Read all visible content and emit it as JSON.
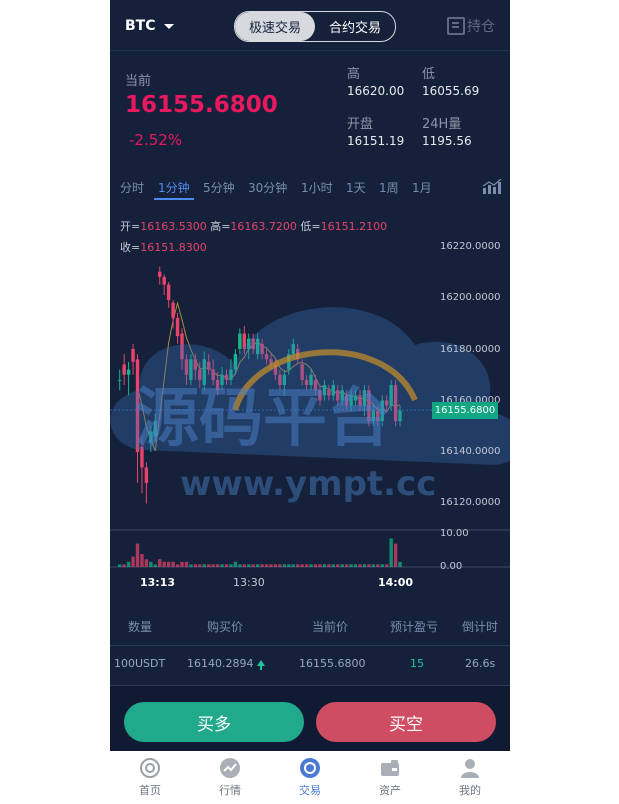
{
  "header": {
    "symbol": "BTC",
    "tabs": [
      "极速交易",
      "合约交易"
    ],
    "active_tab": 0,
    "hold_label": "持仓"
  },
  "ticker": {
    "current_label": "当前",
    "price": "16155.6800",
    "change": "-2.52%",
    "stats": [
      {
        "label": "高",
        "value": "16620.00"
      },
      {
        "label": "低",
        "value": "16055.69"
      },
      {
        "label": "开盘",
        "value": "16151.19"
      },
      {
        "label": "24H量",
        "value": "1195.56"
      }
    ]
  },
  "timeframes": [
    "分时",
    "1分钟",
    "5分钟",
    "30分钟",
    "1小时",
    "1天",
    "1周",
    "1月"
  ],
  "active_timeframe": 1,
  "ohlc": {
    "open_label": "开=",
    "open": "16163.5300",
    "high_label": "高=",
    "high": "16163.7200",
    "low_label": "低=",
    "low": "16151.2100",
    "close_label": "收=",
    "close": "16151.8300"
  },
  "chart": {
    "y_labels": [
      "16220.0000",
      "16200.0000",
      "16180.0000",
      "16160.0000",
      "16140.0000",
      "16120.0000"
    ],
    "current_tag": "16155.6800",
    "vol_labels": [
      "10.00",
      "0.00"
    ],
    "x_labels": [
      "13:13",
      "13:30",
      "14:00"
    ],
    "up_color": "#14b88a",
    "down_color": "#e8436b"
  },
  "chart_data": {
    "type": "candlestick",
    "ylim": [
      16112,
      16235
    ],
    "volume_ylim": [
      0,
      13
    ],
    "x_labels": [
      "13:13",
      "13:30",
      "14:00"
    ],
    "candles": [
      {
        "o": 16168,
        "c": 16168,
        "h": 16172,
        "l": 16164,
        "v": 1
      },
      {
        "o": 16174,
        "c": 16170,
        "h": 16178,
        "l": 16166,
        "v": 1
      },
      {
        "o": 16170,
        "c": 16172,
        "h": 16175,
        "l": 16162,
        "v": 2
      },
      {
        "o": 16180,
        "c": 16175,
        "h": 16182,
        "l": 16170,
        "v": 4
      },
      {
        "o": 16176,
        "c": 16140,
        "h": 16178,
        "l": 16128,
        "v": 9
      },
      {
        "o": 16142,
        "c": 16134,
        "h": 16146,
        "l": 16124,
        "v": 5
      },
      {
        "o": 16134,
        "c": 16128,
        "h": 16136,
        "l": 16120,
        "v": 3
      },
      {
        "o": 16144,
        "c": 16148,
        "h": 16150,
        "l": 16140,
        "v": 2
      },
      {
        "o": 16146,
        "c": 16152,
        "h": 16155,
        "l": 16144,
        "v": 1
      },
      {
        "o": 16210,
        "c": 16208,
        "h": 16212,
        "l": 16205,
        "v": 3
      },
      {
        "o": 16208,
        "c": 16205,
        "h": 16209,
        "l": 16201,
        "v": 2
      },
      {
        "o": 16205,
        "c": 16199,
        "h": 16206,
        "l": 16196,
        "v": 2
      },
      {
        "o": 16198,
        "c": 16192,
        "h": 16199,
        "l": 16188,
        "v": 2
      },
      {
        "o": 16192,
        "c": 16185,
        "h": 16194,
        "l": 16182,
        "v": 1
      },
      {
        "o": 16186,
        "c": 16176,
        "h": 16188,
        "l": 16172,
        "v": 2
      },
      {
        "o": 16176,
        "c": 16170,
        "h": 16178,
        "l": 16166,
        "v": 2
      },
      {
        "o": 16168,
        "c": 16176,
        "h": 16178,
        "l": 16166,
        "v": 1
      },
      {
        "o": 16176,
        "c": 16172,
        "h": 16178,
        "l": 16168,
        "v": 1
      },
      {
        "o": 16172,
        "c": 16168,
        "h": 16175,
        "l": 16165,
        "v": 1
      },
      {
        "o": 16166,
        "c": 16176,
        "h": 16179,
        "l": 16164,
        "v": 1
      },
      {
        "o": 16175,
        "c": 16172,
        "h": 16178,
        "l": 16170,
        "v": 1
      },
      {
        "o": 16172,
        "c": 16168,
        "h": 16176,
        "l": 16166,
        "v": 1
      },
      {
        "o": 16168,
        "c": 16164,
        "h": 16171,
        "l": 16162,
        "v": 1
      },
      {
        "o": 16166,
        "c": 16170,
        "h": 16173,
        "l": 16164,
        "v": 1
      },
      {
        "o": 16170,
        "c": 16168,
        "h": 16172,
        "l": 16166,
        "v": 1
      },
      {
        "o": 16168,
        "c": 16172,
        "h": 16176,
        "l": 16166,
        "v": 1
      },
      {
        "o": 16172,
        "c": 16178,
        "h": 16180,
        "l": 16170,
        "v": 2
      },
      {
        "o": 16180,
        "c": 16186,
        "h": 16188,
        "l": 16178,
        "v": 1
      },
      {
        "o": 16186,
        "c": 16180,
        "h": 16189,
        "l": 16178,
        "v": 1
      },
      {
        "o": 16180,
        "c": 16184,
        "h": 16186,
        "l": 16176,
        "v": 1
      },
      {
        "o": 16184,
        "c": 16180,
        "h": 16186,
        "l": 16178,
        "v": 1
      },
      {
        "o": 16178,
        "c": 16184,
        "h": 16186,
        "l": 16176,
        "v": 1
      },
      {
        "o": 16182,
        "c": 16178,
        "h": 16184,
        "l": 16176,
        "v": 1
      },
      {
        "o": 16178,
        "c": 16176,
        "h": 16180,
        "l": 16174,
        "v": 1
      },
      {
        "o": 16176,
        "c": 16174,
        "h": 16178,
        "l": 16172,
        "v": 1
      },
      {
        "o": 16174,
        "c": 16170,
        "h": 16176,
        "l": 16168,
        "v": 1
      },
      {
        "o": 16170,
        "c": 16166,
        "h": 16172,
        "l": 16164,
        "v": 1
      },
      {
        "o": 16166,
        "c": 16170,
        "h": 16172,
        "l": 16162,
        "v": 1
      },
      {
        "o": 16172,
        "c": 16178,
        "h": 16180,
        "l": 16170,
        "v": 1
      },
      {
        "o": 16178,
        "c": 16182,
        "h": 16184,
        "l": 16176,
        "v": 1
      },
      {
        "o": 16180,
        "c": 16176,
        "h": 16182,
        "l": 16174,
        "v": 1
      },
      {
        "o": 16174,
        "c": 16168,
        "h": 16176,
        "l": 16166,
        "v": 1
      },
      {
        "o": 16168,
        "c": 16166,
        "h": 16170,
        "l": 16164,
        "v": 1
      },
      {
        "o": 16166,
        "c": 16170,
        "h": 16172,
        "l": 16164,
        "v": 1
      },
      {
        "o": 16168,
        "c": 16164,
        "h": 16170,
        "l": 16162,
        "v": 1
      },
      {
        "o": 16164,
        "c": 16160,
        "h": 16166,
        "l": 16158,
        "v": 1
      },
      {
        "o": 16162,
        "c": 16166,
        "h": 16168,
        "l": 16160,
        "v": 1
      },
      {
        "o": 16164,
        "c": 16162,
        "h": 16166,
        "l": 16160,
        "v": 1
      },
      {
        "o": 16162,
        "c": 16166,
        "h": 16168,
        "l": 16160,
        "v": 1
      },
      {
        "o": 16164,
        "c": 16160,
        "h": 16166,
        "l": 16158,
        "v": 1
      },
      {
        "o": 16160,
        "c": 16164,
        "h": 16166,
        "l": 16158,
        "v": 1
      },
      {
        "o": 16162,
        "c": 16158,
        "h": 16164,
        "l": 16156,
        "v": 1
      },
      {
        "o": 16158,
        "c": 16162,
        "h": 16164,
        "l": 16156,
        "v": 1
      },
      {
        "o": 16160,
        "c": 16162,
        "h": 16164,
        "l": 16158,
        "v": 1
      },
      {
        "o": 16162,
        "c": 16158,
        "h": 16164,
        "l": 16156,
        "v": 1
      },
      {
        "o": 16158,
        "c": 16164,
        "h": 16166,
        "l": 16154,
        "v": 1
      },
      {
        "o": 16164,
        "c": 16152,
        "h": 16166,
        "l": 16150,
        "v": 1
      },
      {
        "o": 16152,
        "c": 16156,
        "h": 16158,
        "l": 16150,
        "v": 1
      },
      {
        "o": 16156,
        "c": 16152,
        "h": 16158,
        "l": 16150,
        "v": 1
      },
      {
        "o": 16152,
        "c": 16160,
        "h": 16162,
        "l": 16150,
        "v": 1
      },
      {
        "o": 16160,
        "c": 16158,
        "h": 16162,
        "l": 16156,
        "v": 1
      },
      {
        "o": 16158,
        "c": 16166,
        "h": 16168,
        "l": 16156,
        "v": 11
      },
      {
        "o": 16166,
        "c": 16152,
        "h": 16168,
        "l": 16150,
        "v": 9
      },
      {
        "o": 16152,
        "c": 16156,
        "h": 16158,
        "l": 16150,
        "v": 2
      }
    ]
  },
  "orders": {
    "headers": [
      "数量",
      "购买价",
      "当前价",
      "预计盈亏",
      "倒计时"
    ],
    "rows": [
      {
        "amount": "100USDT",
        "buy_price": "16140.2894",
        "current_price": "16155.6800",
        "pnl": "15",
        "countdown": "26.6s"
      }
    ]
  },
  "actions": {
    "buy": "买多",
    "sell": "买空"
  },
  "nav": [
    {
      "label": "首页",
      "icon": "home-icon"
    },
    {
      "label": "行情",
      "icon": "market-icon"
    },
    {
      "label": "交易",
      "icon": "trade-icon"
    },
    {
      "label": "资产",
      "icon": "wallet-icon"
    },
    {
      "label": "我的",
      "icon": "user-icon"
    }
  ],
  "active_nav": 2,
  "watermark": {
    "line1": "源码平台",
    "line2": "www.ympt.cc"
  }
}
